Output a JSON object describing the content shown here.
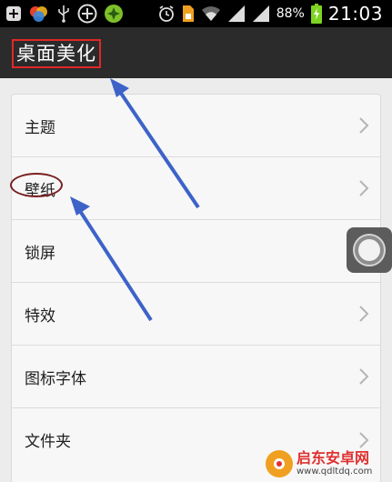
{
  "status_bar": {
    "left_icons": [
      "plus-icon",
      "overlap-circles-icon",
      "usb-icon",
      "add-circle-icon",
      "game-icon"
    ],
    "right_icons": [
      "alarm-icon",
      "sim-icon",
      "wifi-icon",
      "signal-icon",
      "signal-icon",
      "battery-charging-icon"
    ],
    "battery_percent": "88%",
    "time": "21:03"
  },
  "header": {
    "title": "桌面美化"
  },
  "menu": {
    "items": [
      {
        "label": "主题"
      },
      {
        "label": "壁纸"
      },
      {
        "label": "锁屏"
      },
      {
        "label": "特效"
      },
      {
        "label": "图标字体"
      },
      {
        "label": "文件夹"
      }
    ]
  },
  "annotations": {
    "title_box_color": "#e02828",
    "ellipse_color": "#7a1f1f",
    "arrow_color": "#3d63c9"
  },
  "watermark": {
    "title": "启东安卓网",
    "url": "www.qdltdq.com"
  }
}
